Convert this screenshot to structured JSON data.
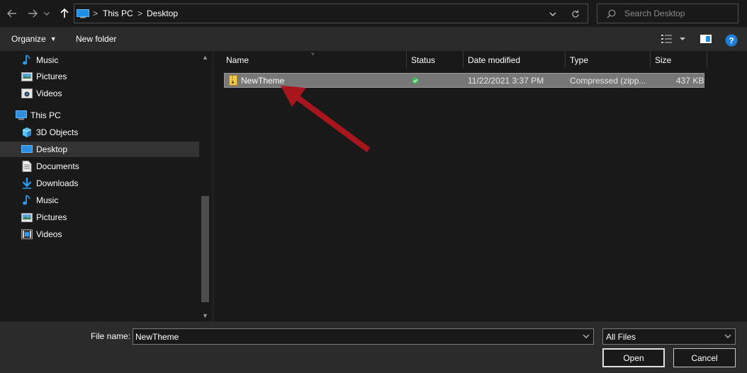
{
  "address": {
    "crumbs": [
      "This PC",
      "Desktop"
    ],
    "separator": ">",
    "icons": {
      "back": "back-arrow-icon",
      "forward": "forward-arrow-icon",
      "recent": "chevron-down-icon",
      "up": "up-arrow-icon",
      "location": "this-pc-icon",
      "dropdown": "chevron-down-icon",
      "refresh": "refresh-icon"
    }
  },
  "search": {
    "placeholder": "Search Desktop",
    "icon": "search-icon"
  },
  "toolbar": {
    "organize_label": "Organize",
    "new_folder_label": "New folder",
    "view_icon": "details-view-icon",
    "preview_icon": "preview-pane-icon",
    "help_icon": "help-icon"
  },
  "nav": {
    "items": [
      {
        "label": "Music",
        "icon": "music-icon"
      },
      {
        "label": "Pictures",
        "icon": "pictures-icon"
      },
      {
        "label": "Videos",
        "icon": "videos-icon"
      },
      {
        "label": "This PC",
        "icon": "this-pc-icon"
      },
      {
        "label": "3D Objects",
        "icon": "3d-objects-icon"
      },
      {
        "label": "Desktop",
        "icon": "desktop-icon",
        "selected": true
      },
      {
        "label": "Documents",
        "icon": "documents-icon"
      },
      {
        "label": "Downloads",
        "icon": "downloads-icon"
      },
      {
        "label": "Music",
        "icon": "music-icon"
      },
      {
        "label": "Pictures",
        "icon": "pictures-icon"
      },
      {
        "label": "Videos",
        "icon": "videos-icon"
      }
    ]
  },
  "columns": [
    "Name",
    "Status",
    "Date modified",
    "Type",
    "Size"
  ],
  "files": [
    {
      "name": "NewTheme",
      "status_icon": "synced-check-icon",
      "date_modified": "11/22/2021 3:37 PM",
      "type": "Compressed (zipp...",
      "size": "437 KB",
      "icon": "zip-folder-icon",
      "selected": true
    }
  ],
  "annotation": {
    "arrow_color": "#a8151d",
    "target": "NewTheme"
  },
  "bottom": {
    "file_name_label": "File name:",
    "file_name_value": "NewTheme",
    "file_type_value": "All Files",
    "open_label": "Open",
    "cancel_label": "Cancel"
  },
  "colors": {
    "background": "#191919",
    "toolbar": "#2b2b2b",
    "selected_row": "#777777",
    "accent_blue": "#1e90e6",
    "status_green": "#3fbf5a"
  }
}
